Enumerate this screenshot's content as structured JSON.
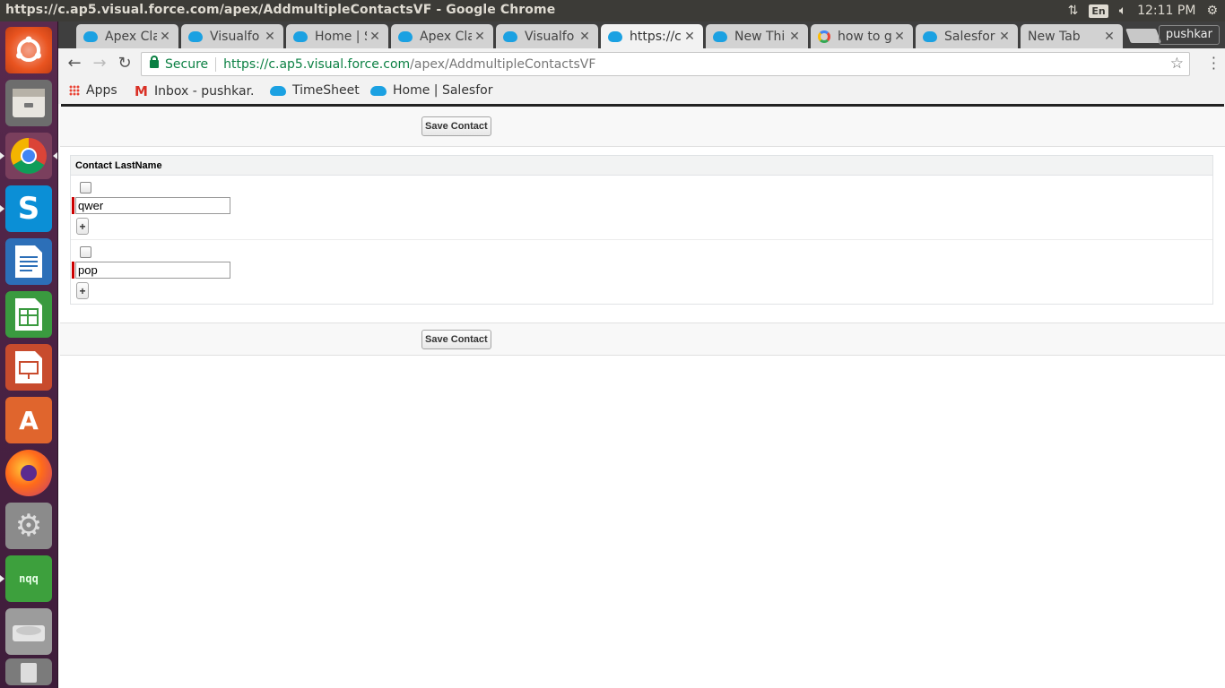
{
  "window": {
    "title": "https://c.ap5.visual.force.com/apex/AddmultipleContactsVF - Google Chrome"
  },
  "system_tray": {
    "keyboard": "En",
    "time": "12:11 PM"
  },
  "launcher": {
    "items": [
      "ubuntu-dash-icon",
      "files-icon",
      "chrome-icon",
      "skype-icon",
      "writer-icon",
      "calc-icon",
      "impress-icon",
      "software-center-icon",
      "firefox-icon",
      "system-tools-icon",
      "nqq-icon",
      "disk-icon",
      "trash-icon"
    ],
    "nqq_label": "nqq"
  },
  "tabs": [
    {
      "label": "Apex Cla",
      "icon": "salesforce-cloud-icon"
    },
    {
      "label": "Visualfo",
      "icon": "salesforce-cloud-icon"
    },
    {
      "label": "Home | S",
      "icon": "salesforce-cloud-icon"
    },
    {
      "label": "Apex Cla",
      "icon": "salesforce-cloud-icon"
    },
    {
      "label": "Visualfo",
      "icon": "salesforce-cloud-icon"
    },
    {
      "label": "https://c",
      "icon": "salesforce-cloud-icon",
      "active": true
    },
    {
      "label": "New Thi",
      "icon": "salesforce-cloud-icon"
    },
    {
      "label": "how to g",
      "icon": "google-icon"
    },
    {
      "label": "Salesfor",
      "icon": "salesforce-cloud-icon"
    },
    {
      "label": "New Tab",
      "icon": ""
    }
  ],
  "profile": {
    "name": "pushkar"
  },
  "omnibox": {
    "secure_label": "Secure",
    "url_host": "https://c.ap5.visual.force.com",
    "url_path": "/apex/AddmultipleContactsVF"
  },
  "bookmarks": {
    "apps": "Apps",
    "gmail": "Inbox - pushkar.",
    "timesheet": "TimeSheet",
    "home_salesforce": "Home | Salesfor"
  },
  "page": {
    "save_button_label": "Save Contact",
    "table": {
      "header": "Contact LastName",
      "rows": [
        {
          "checked": false,
          "last_name": "qwer",
          "add_label": "+"
        },
        {
          "checked": false,
          "last_name": "pop",
          "add_label": "+"
        }
      ]
    }
  },
  "colors": {
    "launcher": "#4a2244",
    "topbar": "#3c3b37",
    "secure_green": "#0b8043",
    "required_red": "#cc0000"
  }
}
